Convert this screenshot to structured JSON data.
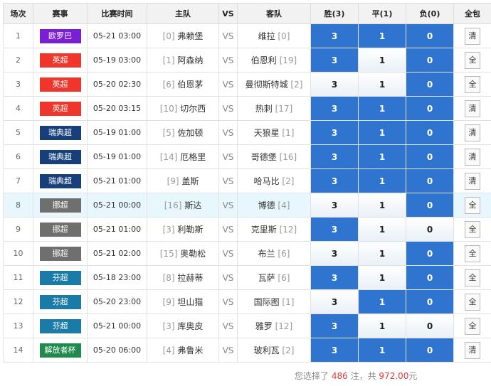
{
  "header": {
    "index": "场次",
    "league": "赛事",
    "time": "比赛时间",
    "home": "主队",
    "vs": "VS",
    "away": "客队",
    "win": "胜(3)",
    "draw": "平(1)",
    "loss": "负(0)",
    "bundle": "全包"
  },
  "rows": [
    {
      "index": "1",
      "league": "欧罗巴",
      "color": "#7a1fd6",
      "time": "05-21 03:00",
      "home_rank": "[0]",
      "home": "弗赖堡",
      "vs": "VS",
      "away": "维拉",
      "away_rank": "[0]",
      "win": "3",
      "draw": "1",
      "loss": "0",
      "selected": [
        true,
        true,
        true
      ],
      "bundle": "清"
    },
    {
      "index": "2",
      "league": "英超",
      "color": "#f0352b",
      "time": "05-19 03:00",
      "home_rank": "[1]",
      "home": "阿森纳",
      "vs": "VS",
      "away": "伯恩利",
      "away_rank": "[19]",
      "win": "3",
      "draw": "1",
      "loss": "0",
      "selected": [
        true,
        false,
        true
      ],
      "bundle": "全"
    },
    {
      "index": "3",
      "league": "英超",
      "color": "#f0352b",
      "time": "05-20 02:30",
      "home_rank": "[6]",
      "home": "伯恩茅",
      "vs": "VS",
      "away": "曼彻斯特城",
      "away_rank": "[2]",
      "win": "3",
      "draw": "1",
      "loss": "0",
      "selected": [
        false,
        false,
        true
      ],
      "bundle": "全"
    },
    {
      "index": "4",
      "league": "英超",
      "color": "#f0352b",
      "time": "05-20 03:15",
      "home_rank": "[10]",
      "home": "切尔西",
      "vs": "VS",
      "away": "热刺",
      "away_rank": "[17]",
      "win": "3",
      "draw": "1",
      "loss": "0",
      "selected": [
        true,
        true,
        true
      ],
      "bundle": "清"
    },
    {
      "index": "5",
      "league": "瑞典超",
      "color": "#17407a",
      "time": "05-19 01:00",
      "home_rank": "[5]",
      "home": "佐加顿",
      "vs": "VS",
      "away": "天狼星",
      "away_rank": "[1]",
      "win": "3",
      "draw": "1",
      "loss": "0",
      "selected": [
        true,
        true,
        true
      ],
      "bundle": "清"
    },
    {
      "index": "6",
      "league": "瑞典超",
      "color": "#17407a",
      "time": "05-19 01:00",
      "home_rank": "[14]",
      "home": "厄格里",
      "vs": "VS",
      "away": "哥德堡",
      "away_rank": "[16]",
      "win": "3",
      "draw": "1",
      "loss": "0",
      "selected": [
        true,
        true,
        true
      ],
      "bundle": "清"
    },
    {
      "index": "7",
      "league": "瑞典超",
      "color": "#17407a",
      "time": "05-21 01:00",
      "home_rank": "[9]",
      "home": "盖斯",
      "vs": "VS",
      "away": "哈马比",
      "away_rank": "[2]",
      "win": "3",
      "draw": "1",
      "loss": "0",
      "selected": [
        true,
        true,
        true
      ],
      "bundle": "清"
    },
    {
      "index": "8",
      "league": "挪超",
      "color": "#6f6f6f",
      "time": "05-21 00:00",
      "home_rank": "[16]",
      "home": "斯达",
      "vs": "VS",
      "away": "博德",
      "away_rank": "[4]",
      "win": "3",
      "draw": "1",
      "loss": "0",
      "selected": [
        false,
        false,
        true
      ],
      "bundle": "全"
    },
    {
      "index": "9",
      "league": "挪超",
      "color": "#6f6f6f",
      "time": "05-21 01:00",
      "home_rank": "[3]",
      "home": "利勒斯",
      "vs": "VS",
      "away": "克里斯",
      "away_rank": "[12]",
      "win": "3",
      "draw": "1",
      "loss": "0",
      "selected": [
        true,
        false,
        false
      ],
      "bundle": "全"
    },
    {
      "index": "10",
      "league": "挪超",
      "color": "#6f6f6f",
      "time": "05-21 02:00",
      "home_rank": "[15]",
      "home": "奥勒松",
      "vs": "VS",
      "away": "布兰",
      "away_rank": "[6]",
      "win": "3",
      "draw": "1",
      "loss": "0",
      "selected": [
        false,
        false,
        true
      ],
      "bundle": "全"
    },
    {
      "index": "11",
      "league": "芬超",
      "color": "#1a7aa8",
      "time": "05-18 23:00",
      "home_rank": "[8]",
      "home": "拉赫蒂",
      "vs": "VS",
      "away": "瓦萨",
      "away_rank": "[6]",
      "win": "3",
      "draw": "1",
      "loss": "0",
      "selected": [
        true,
        false,
        true
      ],
      "bundle": "全"
    },
    {
      "index": "12",
      "league": "芬超",
      "color": "#1a7aa8",
      "time": "05-20 23:00",
      "home_rank": "[9]",
      "home": "坦山猫",
      "vs": "VS",
      "away": "国际图",
      "away_rank": "[1]",
      "win": "3",
      "draw": "1",
      "loss": "0",
      "selected": [
        false,
        true,
        true
      ],
      "bundle": "全"
    },
    {
      "index": "13",
      "league": "芬超",
      "color": "#1a7aa8",
      "time": "05-21 00:00",
      "home_rank": "[3]",
      "home": "库奥皮",
      "vs": "VS",
      "away": "雅罗",
      "away_rank": "[12]",
      "win": "3",
      "draw": "1",
      "loss": "0",
      "selected": [
        true,
        false,
        false
      ],
      "bundle": "全"
    },
    {
      "index": "14",
      "league": "解放者杯",
      "color": "#1e8a4c",
      "time": "05-20 06:00",
      "home_rank": "[4]",
      "home": "弗鲁米",
      "vs": "VS",
      "away": "玻利瓦",
      "away_rank": "[2]",
      "win": "3",
      "draw": "1",
      "loss": "0",
      "selected": [
        true,
        true,
        true
      ],
      "bundle": "清"
    }
  ],
  "summary": {
    "prefix": "您选择了",
    "count": "486",
    "mid": "注，共",
    "amount": "972.00",
    "suffix": "元"
  },
  "colors": {
    "selected": "#2f74cf",
    "highlight_row": "#e8f6fd"
  }
}
